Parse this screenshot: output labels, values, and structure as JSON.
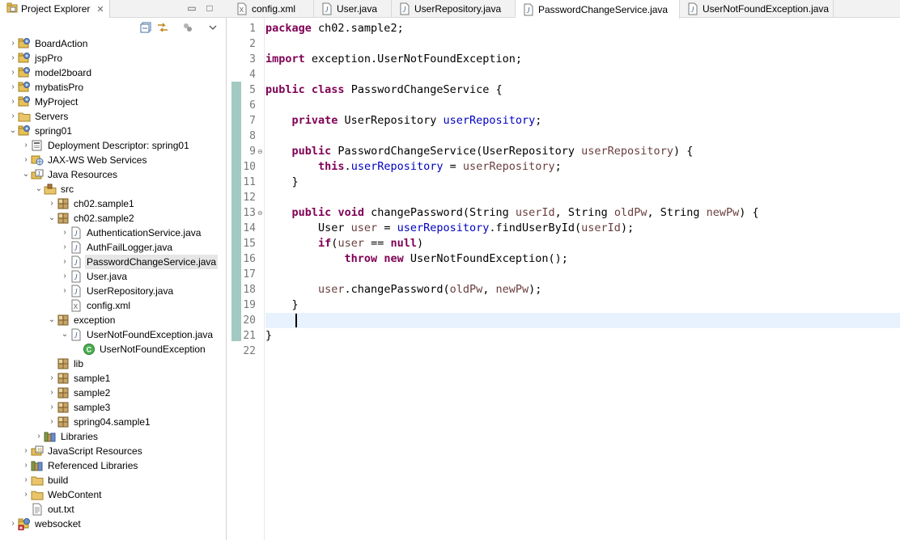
{
  "explorer": {
    "title": "Project Explorer",
    "close_glyph": "✕",
    "minimize_glyph": "▭",
    "maximize_glyph": "□",
    "toolbar": {
      "collapse_all_icon": "collapse-all-icon",
      "link_editor_icon": "link-with-editor-icon",
      "filter_icon": "filter-icon",
      "view_menu_icon": "view-menu-icon"
    },
    "tree": [
      {
        "label": "BoardAction",
        "depth": 0,
        "toggle": "›",
        "icon": "project"
      },
      {
        "label": "jspPro",
        "depth": 0,
        "toggle": "›",
        "icon": "project"
      },
      {
        "label": "model2board",
        "depth": 0,
        "toggle": "›",
        "icon": "project"
      },
      {
        "label": "mybatisPro",
        "depth": 0,
        "toggle": "›",
        "icon": "project"
      },
      {
        "label": "MyProject",
        "depth": 0,
        "toggle": "›",
        "icon": "project"
      },
      {
        "label": "Servers",
        "depth": 0,
        "toggle": "›",
        "icon": "folder"
      },
      {
        "label": "spring01",
        "depth": 0,
        "toggle": "⌄",
        "icon": "project"
      },
      {
        "label": "Deployment Descriptor: spring01",
        "depth": 1,
        "toggle": "›",
        "icon": "descriptor"
      },
      {
        "label": "JAX-WS Web Services",
        "depth": 1,
        "toggle": "›",
        "icon": "webservices"
      },
      {
        "label": "Java Resources",
        "depth": 1,
        "toggle": "⌄",
        "icon": "javares"
      },
      {
        "label": "src",
        "depth": 2,
        "toggle": "⌄",
        "icon": "srcfolder"
      },
      {
        "label": "ch02.sample1",
        "depth": 3,
        "toggle": "›",
        "icon": "package"
      },
      {
        "label": "ch02.sample2",
        "depth": 3,
        "toggle": "⌄",
        "icon": "package"
      },
      {
        "label": "AuthenticationService.java",
        "depth": 4,
        "toggle": "›",
        "icon": "javafile"
      },
      {
        "label": "AuthFailLogger.java",
        "depth": 4,
        "toggle": "›",
        "icon": "javafile"
      },
      {
        "label": "PasswordChangeService.java",
        "depth": 4,
        "toggle": "›",
        "icon": "javafile",
        "selected": true
      },
      {
        "label": "User.java",
        "depth": 4,
        "toggle": "›",
        "icon": "javafile"
      },
      {
        "label": "UserRepository.java",
        "depth": 4,
        "toggle": "›",
        "icon": "javafile"
      },
      {
        "label": "config.xml",
        "depth": 4,
        "toggle": "",
        "icon": "xmlfile"
      },
      {
        "label": "exception",
        "depth": 3,
        "toggle": "⌄",
        "icon": "package"
      },
      {
        "label": "UserNotFoundException.java",
        "depth": 4,
        "toggle": "⌄",
        "icon": "javafile"
      },
      {
        "label": "UserNotFoundException",
        "depth": 5,
        "toggle": "",
        "icon": "class"
      },
      {
        "label": "lib",
        "depth": 3,
        "toggle": "",
        "icon": "package"
      },
      {
        "label": "sample1",
        "depth": 3,
        "toggle": "›",
        "icon": "package"
      },
      {
        "label": "sample2",
        "depth": 3,
        "toggle": "›",
        "icon": "package"
      },
      {
        "label": "sample3",
        "depth": 3,
        "toggle": "›",
        "icon": "package"
      },
      {
        "label": "spring04.sample1",
        "depth": 3,
        "toggle": "›",
        "icon": "package"
      },
      {
        "label": "Libraries",
        "depth": 2,
        "toggle": "›",
        "icon": "library"
      },
      {
        "label": "JavaScript Resources",
        "depth": 1,
        "toggle": "›",
        "icon": "jsres"
      },
      {
        "label": "Referenced Libraries",
        "depth": 1,
        "toggle": "›",
        "icon": "library"
      },
      {
        "label": "build",
        "depth": 1,
        "toggle": "›",
        "icon": "folder"
      },
      {
        "label": "WebContent",
        "depth": 1,
        "toggle": "›",
        "icon": "folder"
      },
      {
        "label": "out.txt",
        "depth": 1,
        "toggle": "",
        "icon": "textfile"
      },
      {
        "label": "websocket",
        "depth": 0,
        "toggle": "›",
        "icon": "project-error"
      }
    ]
  },
  "editor": {
    "tabs": [
      {
        "label": "config.xml",
        "icon": "xml-file-icon",
        "active": false
      },
      {
        "label": "User.java",
        "icon": "java-file-icon",
        "active": false
      },
      {
        "label": "UserRepository.java",
        "icon": "java-file-icon",
        "active": false
      },
      {
        "label": "PasswordChangeService.java",
        "icon": "java-file-icon",
        "active": true
      },
      {
        "label": "UserNotFoundException.java",
        "icon": "java-file-icon",
        "active": false
      }
    ],
    "current_line": 20,
    "fold_markers": [
      9,
      13
    ],
    "lines": [
      [
        {
          "t": "package",
          "c": "kw"
        },
        {
          "t": " ch02.sample2;"
        }
      ],
      [],
      [
        {
          "t": "import",
          "c": "kw"
        },
        {
          "t": " exception.UserNotFoundException;"
        }
      ],
      [],
      [
        {
          "t": "public",
          "c": "kw"
        },
        {
          "t": " "
        },
        {
          "t": "class",
          "c": "kw"
        },
        {
          "t": " PasswordChangeService {"
        }
      ],
      [],
      [
        {
          "t": "    "
        },
        {
          "t": "private",
          "c": "kw"
        },
        {
          "t": " UserRepository "
        },
        {
          "t": "userRepository",
          "c": "fld"
        },
        {
          "t": ";"
        }
      ],
      [],
      [
        {
          "t": "    "
        },
        {
          "t": "public",
          "c": "kw"
        },
        {
          "t": " PasswordChangeService(UserRepository "
        },
        {
          "t": "userRepository",
          "c": "prm"
        },
        {
          "t": ") {"
        }
      ],
      [
        {
          "t": "        "
        },
        {
          "t": "this",
          "c": "kw"
        },
        {
          "t": "."
        },
        {
          "t": "userRepository",
          "c": "fld"
        },
        {
          "t": " = "
        },
        {
          "t": "userRepository",
          "c": "prm"
        },
        {
          "t": ";"
        }
      ],
      [
        {
          "t": "    }"
        }
      ],
      [],
      [
        {
          "t": "    "
        },
        {
          "t": "public",
          "c": "kw"
        },
        {
          "t": " "
        },
        {
          "t": "void",
          "c": "kw"
        },
        {
          "t": " changePassword(String "
        },
        {
          "t": "userId",
          "c": "prm"
        },
        {
          "t": ", String "
        },
        {
          "t": "oldPw",
          "c": "prm"
        },
        {
          "t": ", String "
        },
        {
          "t": "newPw",
          "c": "prm"
        },
        {
          "t": ") {"
        }
      ],
      [
        {
          "t": "        User "
        },
        {
          "t": "user",
          "c": "prm"
        },
        {
          "t": " = "
        },
        {
          "t": "userRepository",
          "c": "fld"
        },
        {
          "t": ".findUserById("
        },
        {
          "t": "userId",
          "c": "prm"
        },
        {
          "t": ");"
        }
      ],
      [
        {
          "t": "        "
        },
        {
          "t": "if",
          "c": "kw"
        },
        {
          "t": "("
        },
        {
          "t": "user",
          "c": "prm"
        },
        {
          "t": " == "
        },
        {
          "t": "null",
          "c": "kw"
        },
        {
          "t": ")"
        }
      ],
      [
        {
          "t": "            "
        },
        {
          "t": "throw",
          "c": "kw"
        },
        {
          "t": " "
        },
        {
          "t": "new",
          "c": "kw"
        },
        {
          "t": " UserNotFoundException();"
        }
      ],
      [],
      [
        {
          "t": "        "
        },
        {
          "t": "user",
          "c": "prm"
        },
        {
          "t": ".changePassword("
        },
        {
          "t": "oldPw",
          "c": "prm"
        },
        {
          "t": ", "
        },
        {
          "t": "newPw",
          "c": "prm"
        },
        {
          "t": ");"
        }
      ],
      [
        {
          "t": "    }"
        }
      ],
      [
        {
          "t": "    "
        }
      ],
      [
        {
          "t": "}"
        }
      ],
      []
    ]
  },
  "colors": {
    "keyword": "#7f0055",
    "field": "#0000c0",
    "local": "#6a3e3e",
    "current_line": "#e8f2fe",
    "ruler": "#a2c9c2"
  }
}
